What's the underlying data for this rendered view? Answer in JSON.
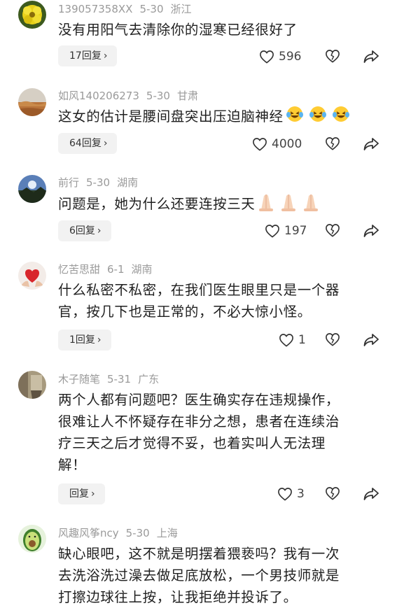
{
  "comments": [
    {
      "user": "139057358XX",
      "date": "5-30",
      "location": "浙江",
      "text": "没有用阳气去清除你的湿寒已经很好了",
      "reply_label": "17回复",
      "likes": "596",
      "avatar": "yellow-flower-avatar"
    },
    {
      "user": "如风140206273",
      "date": "5-30",
      "location": "甘肃",
      "text": "这女的估计是腰间盘突出压迫脑神经",
      "reply_label": "64回复",
      "likes": "4000",
      "avatar": "desert-avatar",
      "emoji": "laughing-crying-face-icon"
    },
    {
      "user": "前行",
      "date": "5-30",
      "location": "湖南",
      "text": "问题是，她为什么还要连按三天",
      "reply_label": "6回复",
      "likes": "197",
      "avatar": "landscape-avatar",
      "emoji": "praying-hands-icon"
    },
    {
      "user": "忆苦思甜",
      "date": "6-1",
      "location": "湖南",
      "text_lines": [
        "什么私密不私密，在我们医生眼里只是一个器",
        "官，按几下也是正常的，不必大惊小怪。"
      ],
      "reply_label": "1回复",
      "likes": "1",
      "avatar": "heart-hands-avatar"
    },
    {
      "user": "木子随笔",
      "date": "5-31",
      "location": "广东",
      "text_lines": [
        "两个人都有问题吧？医生确实存在违规操作，",
        "很难让人不怀疑存在非分之想，患者在连续治",
        "疗三天之后才觉得不妥，也着实叫人无法理",
        "解！"
      ],
      "reply_label": "回复",
      "likes": "3",
      "avatar": "sepia-photo-avatar"
    },
    {
      "user": "风趣风筝ncy",
      "date": "5-30",
      "location": "上海",
      "text_lines": [
        "缺心眼吧，这不就是明摆着猥亵吗？我有一次",
        "去洗浴洗过澡去做足底放松，一个男技师就是",
        "打擦边球往上按，让我拒绝并投诉了。"
      ],
      "avatar": "avocado-avatar"
    }
  ],
  "icons": {
    "like": "heart-outline-icon",
    "dislike": "broken-heart-icon",
    "share": "share-arrow-icon",
    "reply_chevron": "chevron-right-icon"
  },
  "chevron": "›"
}
